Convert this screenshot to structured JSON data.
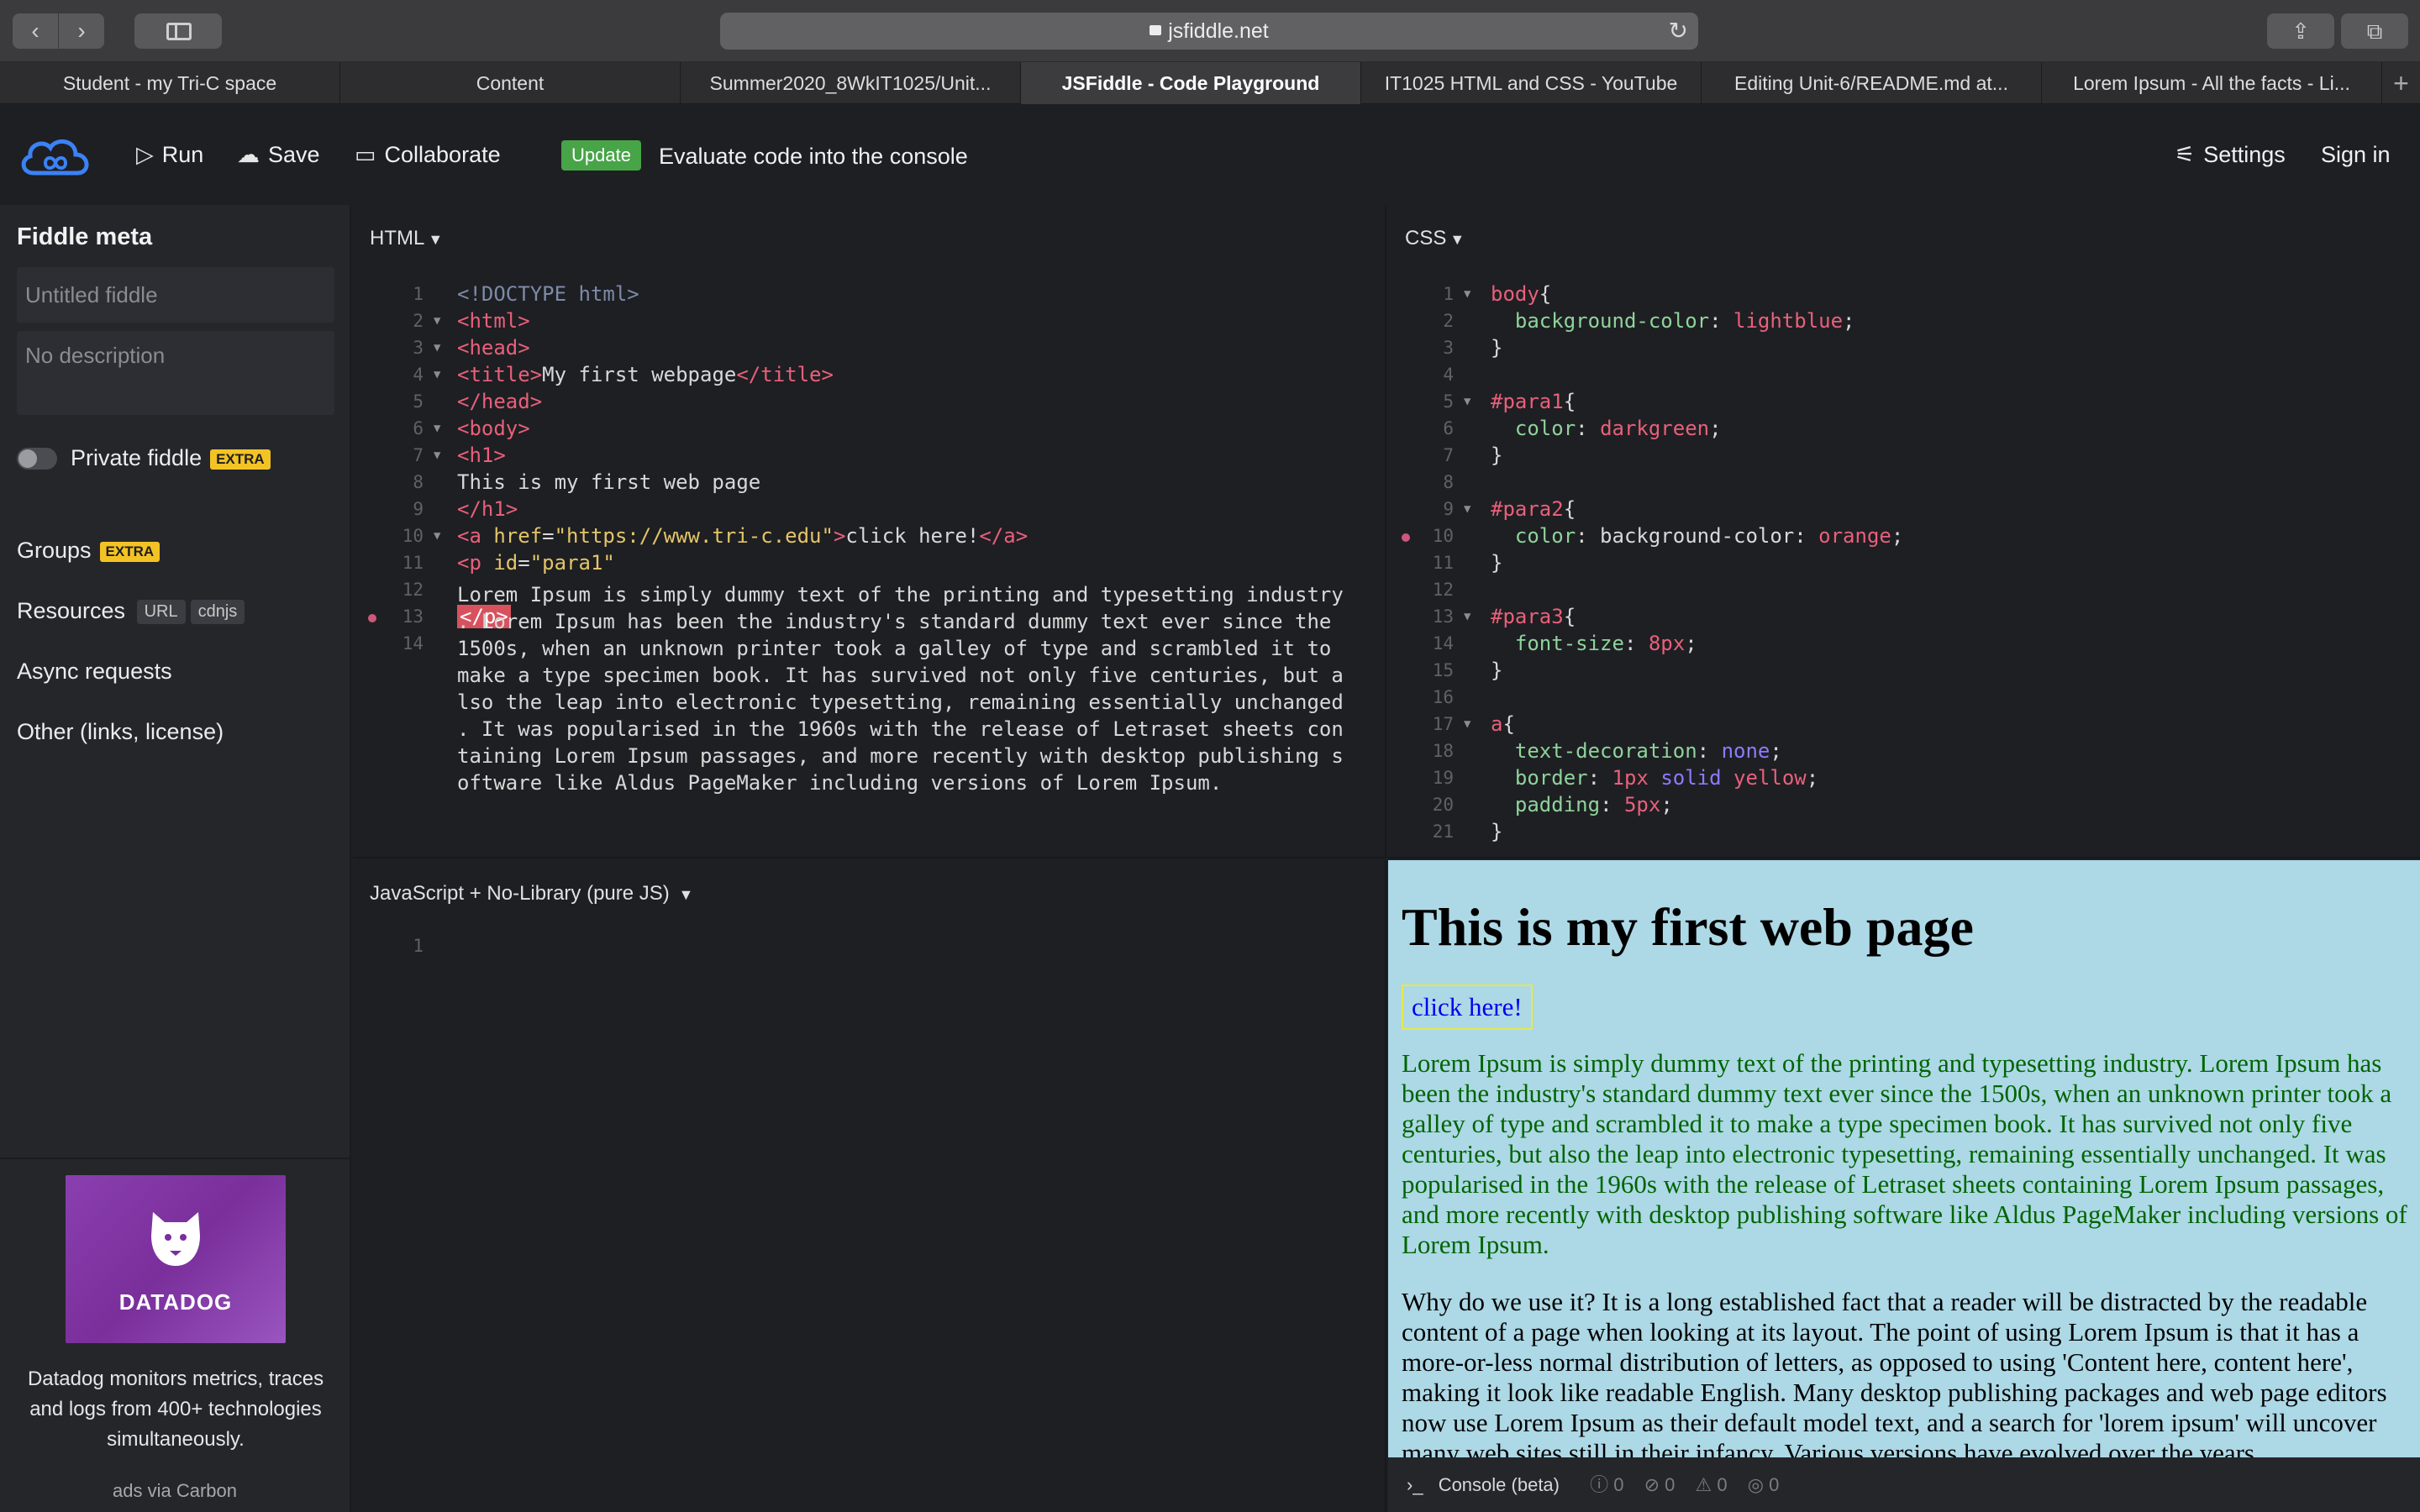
{
  "browser": {
    "url": "jsfiddle.net",
    "tabs": [
      {
        "label": "Student - my Tri-C space",
        "active": false
      },
      {
        "label": "Content",
        "active": false
      },
      {
        "label": "Summer2020_8WkIT1025/Unit...",
        "active": false
      },
      {
        "label": "JSFiddle - Code Playground",
        "active": true
      },
      {
        "label": "IT1025 HTML and CSS - YouTube",
        "active": false
      },
      {
        "label": "Editing Unit-6/README.md at...",
        "active": false
      },
      {
        "label": "Lorem Ipsum - All the facts - Li...",
        "active": false
      }
    ]
  },
  "toolbar": {
    "run": "Run",
    "save": "Save",
    "collaborate": "Collaborate",
    "update_badge": "Update",
    "evaluate_text": "Evaluate code into the console",
    "settings": "Settings",
    "sign_in": "Sign in"
  },
  "sidebar": {
    "title": "Fiddle meta",
    "name_placeholder": "Untitled fiddle",
    "description_placeholder": "No description",
    "private_label": "Private fiddle",
    "extra": "EXTRA",
    "groups": "Groups",
    "resources": "Resources",
    "url_chip": "URL",
    "cdnjs_chip": "cdnjs",
    "async": "Async requests",
    "other": "Other (links, license)",
    "ad_brand": "DATADOG",
    "ad_text": "Datadog monitors metrics, traces and logs from 400+ technologies simultaneously.",
    "ad_via": "ads via Carbon"
  },
  "panels": {
    "html_title": "HTML",
    "css_title": "CSS",
    "js_title": "JavaScript + No-Library (pure JS)",
    "js_line": "1"
  },
  "html_code": {
    "paragraph": "Lorem Ipsum is simply dummy text of the printing and typesetting industry\n. Lorem Ipsum has been the industry's standard dummy text ever since the\n1500s, when an unknown printer took a galley of type and scrambled it to\nmake a type specimen book. It has survived not only five centuries, but a\nlso the leap into electronic typesetting, remaining essentially unchanged\n. It was popularised in the 1960s with the release of Letraset sheets con\ntaining Lorem Ipsum passages, and more recently with desktop publishing s\noftware like Aldus PageMaker including versions of Lorem Ipsum."
  },
  "result": {
    "heading": "This is my first web page",
    "link": "click here!",
    "para1": "Lorem Ipsum is simply dummy text of the printing and typesetting industry. Lorem Ipsum has been the industry's standard dummy text ever since the 1500s, when an unknown printer took a galley of type and scrambled it to make a type specimen book. It has survived not only five centuries, but also the leap into electronic typesetting, remaining essentially unchanged. It was popularised in the 1960s with the release of Letraset sheets containing Lorem Ipsum passages, and more recently with desktop publishing software like Aldus PageMaker including versions of Lorem Ipsum.",
    "para2": "Why do we use it? It is a long established fact that a reader will be distracted by the readable content of a page when looking at its layout. The point of using Lorem Ipsum is that it has a more-or-less normal distribution of letters, as opposed to using 'Content here, content here', making it look like readable English. Many desktop publishing packages and web page editors now use Lorem Ipsum as their default model text, and a search for 'lorem ipsum' will uncover many web sites still in their infancy. Various versions have evolved over the years"
  },
  "console": {
    "label": "Console (beta)",
    "info_count": "0",
    "error_count": "0",
    "warn_count": "0",
    "log_count": "0"
  },
  "colors": {
    "accent_blue": "#3b82f6",
    "update_green": "#47a447",
    "extra_yellow": "#f3c325",
    "result_bg": "#add8e6"
  }
}
